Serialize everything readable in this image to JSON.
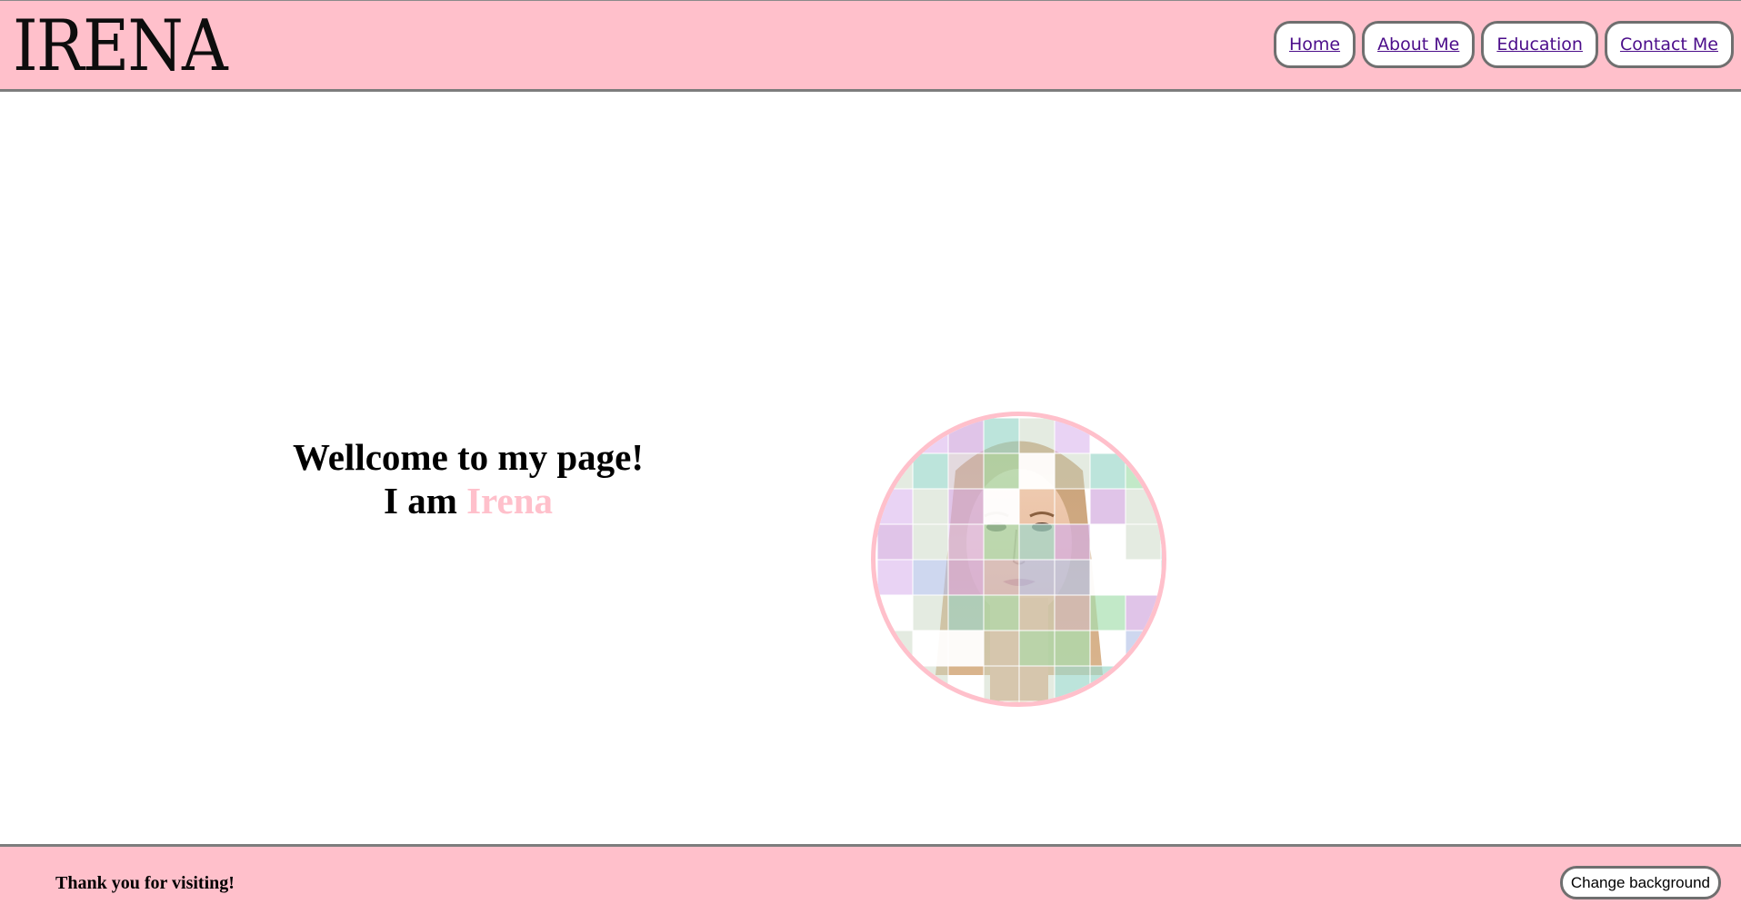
{
  "header": {
    "logo": "IRENA",
    "nav": [
      {
        "label": "Home"
      },
      {
        "label": "About Me"
      },
      {
        "label": "Education"
      },
      {
        "label": "Contact Me"
      }
    ]
  },
  "main": {
    "welcome_line1": "Wellcome to my page!",
    "welcome_line2_prefix": "I am ",
    "welcome_name": "Irena",
    "photo": {
      "icon": "portrait-mosaic-image",
      "description_tiles": true
    }
  },
  "footer": {
    "text": "Thank you for visiting!",
    "button_label": "Change background"
  },
  "colors": {
    "accent_pink": "#ffc0cb",
    "link_purple": "#4b0d8a",
    "border_gray": "#7d7d7d"
  }
}
